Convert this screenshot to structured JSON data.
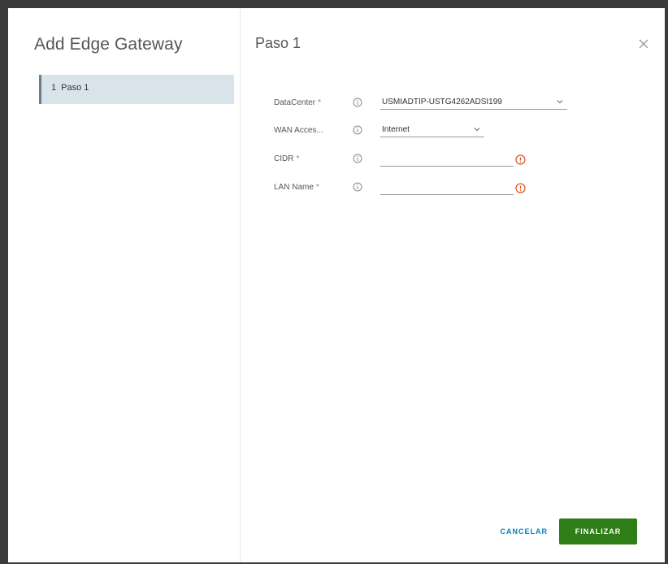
{
  "wizard": {
    "title": "Add Edge Gateway",
    "steps": [
      {
        "number": "1",
        "label": "Paso 1"
      }
    ]
  },
  "page": {
    "title": "Paso 1"
  },
  "form": {
    "datacenter": {
      "label": "DataCenter",
      "required_mark": "*",
      "value": "USMIADTIP-USTG4262ADSI199"
    },
    "wan_access": {
      "label": "WAN Acces...",
      "value": "Internet"
    },
    "cidr": {
      "label": "CIDR",
      "required_mark": "*",
      "value": ""
    },
    "lan_name": {
      "label": "LAN Name",
      "required_mark": "*",
      "value": ""
    }
  },
  "footer": {
    "cancel_label": "CANCELAR",
    "finish_label": "FINALIZAR"
  },
  "colors": {
    "accent_link": "#0a7fbf",
    "primary_button": "#2e7d16",
    "error": "#e05a2b",
    "step_selected_bg": "#d9e4ea"
  },
  "icons": [
    "close-icon",
    "info-icon",
    "chevron-down-icon",
    "error-icon"
  ]
}
